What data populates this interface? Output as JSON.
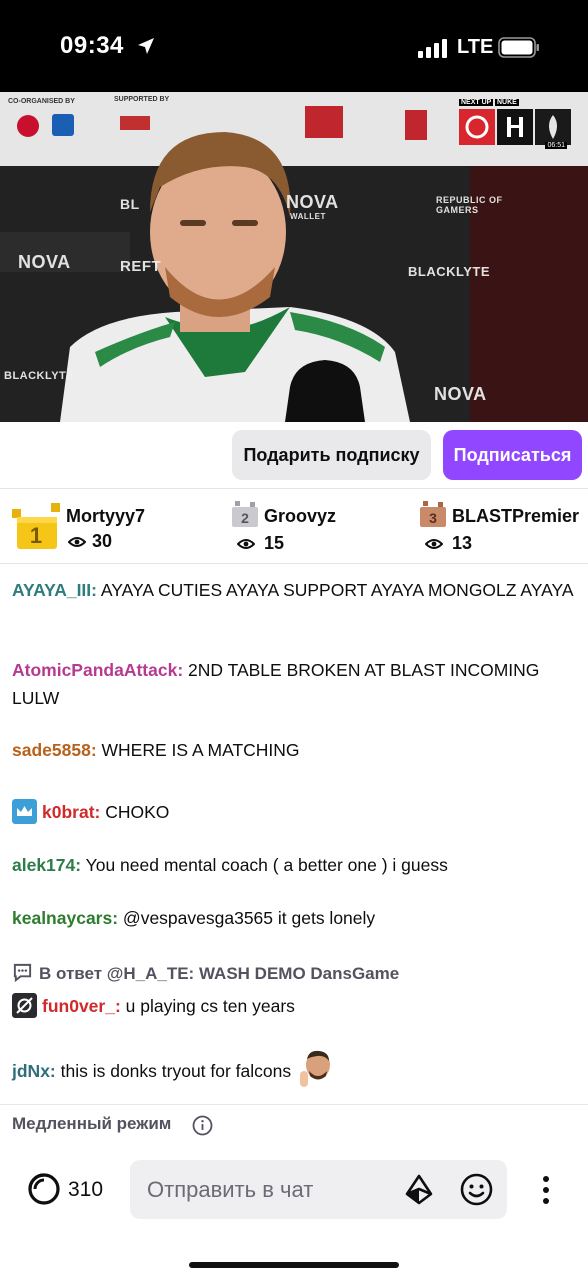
{
  "status_bar": {
    "time": "09:34",
    "network": "LTE"
  },
  "video": {
    "top_labels": {
      "co_organised": "CO-ORGANISED BY",
      "supported": "SUPPORTED BY",
      "next_up": "NEXT UP",
      "map": "NUKE",
      "timer": "06:51"
    },
    "wall_texts": [
      "NOVA",
      "WALLET",
      "REPUBLIC OF GAMERS",
      "BLACKLYTE",
      "REFT",
      "BL"
    ]
  },
  "subscribe_row": {
    "gift_label": "Подарить подписку",
    "subscribe_label": "Подписаться"
  },
  "leaderboard": [
    {
      "rank": "1",
      "name": "Mortyyy7",
      "count": "30"
    },
    {
      "rank": "2",
      "name": "Groovyz",
      "count": "15"
    },
    {
      "rank": "3",
      "name": "BLASTPremier",
      "count": "13"
    }
  ],
  "chat": [
    {
      "user": "AYAYA_III:",
      "color": "#2e7c7c",
      "text": " AYAYA CUTIES AYAYA SUPPORT AYAYA MONGOLZ AYAYA"
    },
    {
      "user": "AtomicPandaAttack:",
      "color": "#b63a8f",
      "text": " 2ND TABLE BROKEN AT BLAST INCOMING LULW"
    },
    {
      "user": "sade5858:",
      "color": "#b8621b",
      "text": " WHERE IS A MATCHING"
    },
    {
      "user": "k0brat:",
      "color": "#d12a2a",
      "text": " CHOKO",
      "badge": "crown-badge"
    },
    {
      "user": "alek174:",
      "color": "#2e7c4a",
      "text": " You need mental coach ( a better one ) i guess"
    },
    {
      "user": "kealnaycars:",
      "color": "#2e7c2e",
      "text": " @vespavesga3565 it gets lonely"
    },
    {
      "reply": "В ответ @H_A_TE: WASH DEMO  DansGame"
    },
    {
      "user": "fun0ver_:",
      "color": "#d12a2a",
      "text": " u playing cs ten years",
      "badge": "no-audio-badge"
    },
    {
      "user": "jdNx:",
      "color": "#2e6e7c",
      "text": " this is donks tryout for falcons",
      "emote": "face-emote"
    }
  ],
  "slow_mode_label": "Медленный режим",
  "input_bar": {
    "points": "310",
    "placeholder": "Отправить в чат"
  },
  "colors": {
    "accent": "#9147ff",
    "gift_bg": "#e9e9ec",
    "input_bg": "#efeff1"
  }
}
